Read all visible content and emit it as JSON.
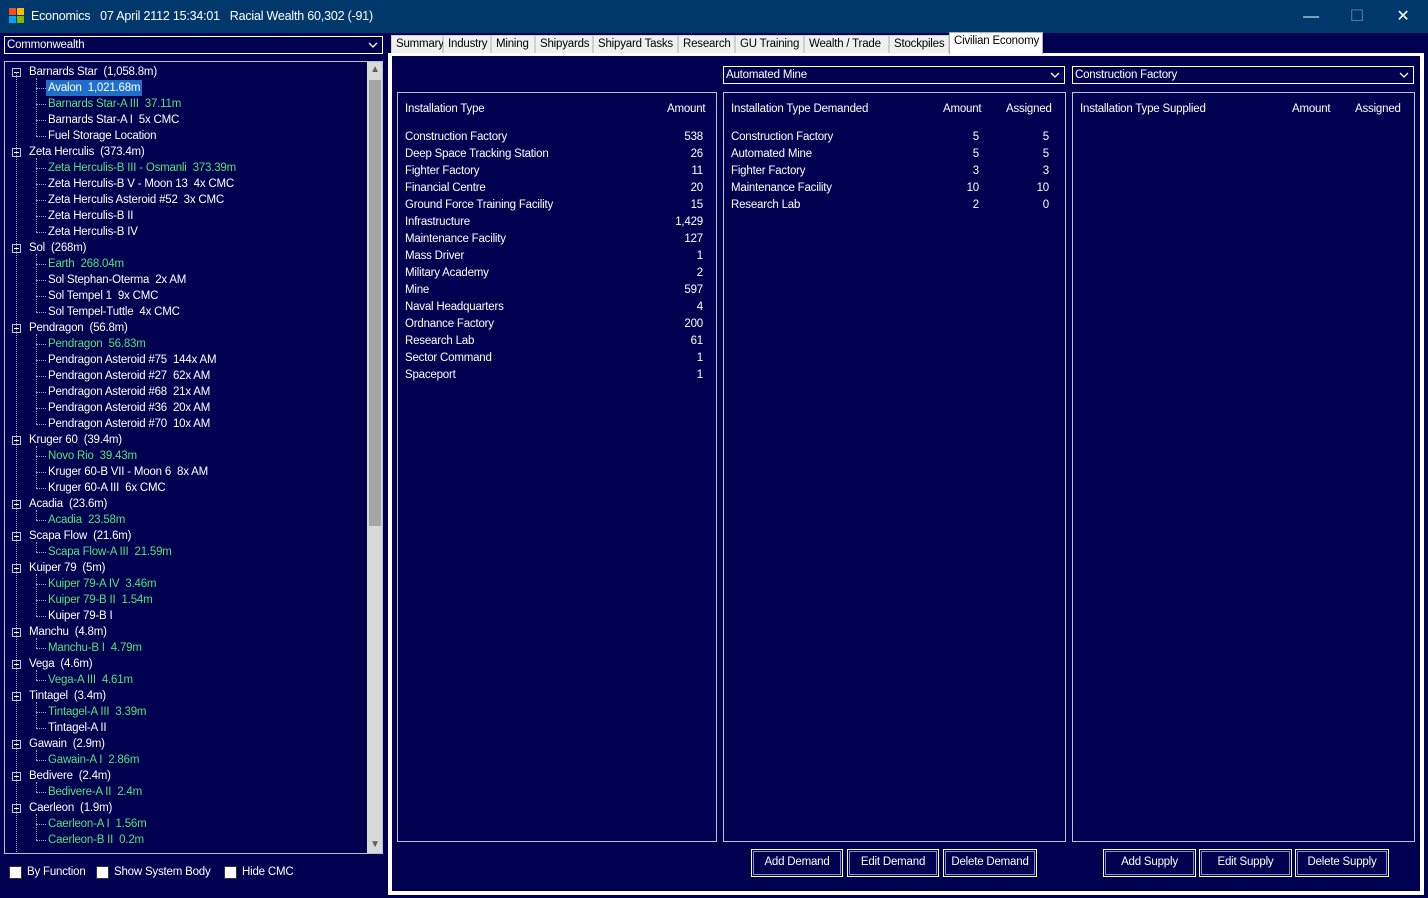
{
  "window": {
    "title": "Economics   07 April 2112 15:34:01   Racial Wealth 60,302 (-91)",
    "minimize_icon": "minimize-icon",
    "maximize_icon": "maximize-icon",
    "close_icon": "close-icon",
    "minimize_glyph": "—",
    "maximize_glyph": "☐",
    "close_glyph": "✕"
  },
  "race_select": {
    "value": "Commonwealth"
  },
  "tree": {
    "rows": [
      {
        "type": "system",
        "label": "Barnards Star  (1,058.8m)"
      },
      {
        "type": "body",
        "label": "Avalon  1,021.68m",
        "color": "green",
        "selected": true
      },
      {
        "type": "body",
        "label": "Barnards Star-A III  37.11m",
        "color": "green"
      },
      {
        "type": "body",
        "label": "Barnards Star-A I  5x CMC",
        "color": "white"
      },
      {
        "type": "body",
        "label": "Fuel Storage Location",
        "color": "white"
      },
      {
        "type": "system",
        "label": "Zeta Herculis  (373.4m)"
      },
      {
        "type": "body",
        "label": "Zeta Herculis-B III - Osmanli  373.39m",
        "color": "green"
      },
      {
        "type": "body",
        "label": "Zeta Herculis-B V - Moon 13  4x CMC",
        "color": "white"
      },
      {
        "type": "body",
        "label": "Zeta Herculis Asteroid #52  3x CMC",
        "color": "white"
      },
      {
        "type": "body",
        "label": "Zeta Herculis-B II",
        "color": "white"
      },
      {
        "type": "body",
        "label": "Zeta Herculis-B IV",
        "color": "white"
      },
      {
        "type": "system",
        "label": "Sol  (268m)"
      },
      {
        "type": "body",
        "label": "Earth  268.04m",
        "color": "green"
      },
      {
        "type": "body",
        "label": "Sol Stephan-Oterma  2x AM",
        "color": "white"
      },
      {
        "type": "body",
        "label": "Sol Tempel 1  9x CMC",
        "color": "white"
      },
      {
        "type": "body",
        "label": "Sol Tempel-Tuttle  4x CMC",
        "color": "white"
      },
      {
        "type": "system",
        "label": "Pendragon  (56.8m)"
      },
      {
        "type": "body",
        "label": "Pendragon  56.83m",
        "color": "green"
      },
      {
        "type": "body",
        "label": "Pendragon Asteroid #75  144x AM",
        "color": "white"
      },
      {
        "type": "body",
        "label": "Pendragon Asteroid #27  62x AM",
        "color": "white"
      },
      {
        "type": "body",
        "label": "Pendragon Asteroid #68  21x AM",
        "color": "white"
      },
      {
        "type": "body",
        "label": "Pendragon Asteroid #36  20x AM",
        "color": "white"
      },
      {
        "type": "body",
        "label": "Pendragon Asteroid #70  10x AM",
        "color": "white"
      },
      {
        "type": "system",
        "label": "Kruger 60  (39.4m)"
      },
      {
        "type": "body",
        "label": "Novo Rio  39.43m",
        "color": "green"
      },
      {
        "type": "body",
        "label": "Kruger 60-B VII - Moon 6  8x AM",
        "color": "white"
      },
      {
        "type": "body",
        "label": "Kruger 60-A III  6x CMC",
        "color": "white"
      },
      {
        "type": "system",
        "label": "Acadia  (23.6m)"
      },
      {
        "type": "body",
        "label": "Acadia  23.58m",
        "color": "green"
      },
      {
        "type": "system",
        "label": "Scapa Flow  (21.6m)"
      },
      {
        "type": "body",
        "label": "Scapa Flow-A III  21.59m",
        "color": "green"
      },
      {
        "type": "system",
        "label": "Kuiper 79  (5m)"
      },
      {
        "type": "body",
        "label": "Kuiper 79-A IV  3.46m",
        "color": "green"
      },
      {
        "type": "body",
        "label": "Kuiper 79-B II  1.54m",
        "color": "green"
      },
      {
        "type": "body",
        "label": "Kuiper 79-B I",
        "color": "white"
      },
      {
        "type": "system",
        "label": "Manchu  (4.8m)"
      },
      {
        "type": "body",
        "label": "Manchu-B I  4.79m",
        "color": "green"
      },
      {
        "type": "system",
        "label": "Vega  (4.6m)"
      },
      {
        "type": "body",
        "label": "Vega-A III  4.61m",
        "color": "green"
      },
      {
        "type": "system",
        "label": "Tintagel  (3.4m)"
      },
      {
        "type": "body",
        "label": "Tintagel-A III  3.39m",
        "color": "green"
      },
      {
        "type": "body",
        "label": "Tintagel-A II",
        "color": "white"
      },
      {
        "type": "system",
        "label": "Gawain  (2.9m)"
      },
      {
        "type": "body",
        "label": "Gawain-A I  2.86m",
        "color": "green"
      },
      {
        "type": "system",
        "label": "Bedivere  (2.4m)"
      },
      {
        "type": "body",
        "label": "Bedivere-A II  2.4m",
        "color": "green"
      },
      {
        "type": "system",
        "label": "Caerleon  (1.9m)"
      },
      {
        "type": "body",
        "label": "Caerleon-A I  1.56m",
        "color": "green"
      },
      {
        "type": "body",
        "label": "Caerleon-B II  0.2m",
        "color": "green"
      }
    ]
  },
  "checkboxes": {
    "by_function": "By Function",
    "show_system_body": "Show System Body",
    "hide_cmc": "Hide CMC"
  },
  "tabs": [
    {
      "label": "Summary"
    },
    {
      "label": "Industry"
    },
    {
      "label": "Mining"
    },
    {
      "label": "Shipyards"
    },
    {
      "label": "Shipyard Tasks"
    },
    {
      "label": "Research"
    },
    {
      "label": "GU Training"
    },
    {
      "label": "Wealth / Trade"
    },
    {
      "label": "Stockpiles"
    },
    {
      "label": "Civilian Economy",
      "active": true
    }
  ],
  "installations": {
    "headers": {
      "type": "Installation Type",
      "amount": "Amount"
    },
    "rows": [
      {
        "type": "Construction Factory",
        "amount": "538"
      },
      {
        "type": "Deep Space Tracking Station",
        "amount": "26"
      },
      {
        "type": "Fighter Factory",
        "amount": "11"
      },
      {
        "type": "Financial Centre",
        "amount": "20"
      },
      {
        "type": "Ground Force Training Facility",
        "amount": "15"
      },
      {
        "type": "Infrastructure",
        "amount": "1,429"
      },
      {
        "type": "Maintenance Facility",
        "amount": "127"
      },
      {
        "type": "Mass Driver",
        "amount": "1"
      },
      {
        "type": "Military Academy",
        "amount": "2"
      },
      {
        "type": "Mine",
        "amount": "597"
      },
      {
        "type": "Naval Headquarters",
        "amount": "4"
      },
      {
        "type": "Ordnance Factory",
        "amount": "200"
      },
      {
        "type": "Research Lab",
        "amount": "61"
      },
      {
        "type": "Sector Command",
        "amount": "1"
      },
      {
        "type": "Spaceport",
        "amount": "1"
      }
    ]
  },
  "demand": {
    "select_value": "Automated Mine",
    "headers": {
      "type": "Installation Type Demanded",
      "amount": "Amount",
      "assigned": "Assigned"
    },
    "rows": [
      {
        "type": "Construction Factory",
        "amount": "5",
        "assigned": "5"
      },
      {
        "type": "Automated Mine",
        "amount": "5",
        "assigned": "5"
      },
      {
        "type": "Fighter Factory",
        "amount": "3",
        "assigned": "3"
      },
      {
        "type": "Maintenance Facility",
        "amount": "10",
        "assigned": "10"
      },
      {
        "type": "Research Lab",
        "amount": "2",
        "assigned": "0"
      }
    ],
    "buttons": {
      "add": "Add Demand",
      "edit": "Edit Demand",
      "delete": "Delete Demand"
    }
  },
  "supply": {
    "select_value": "Construction Factory",
    "headers": {
      "type": "Installation Type Supplied",
      "amount": "Amount",
      "assigned": "Assigned"
    },
    "rows": [],
    "buttons": {
      "add": "Add Supply",
      "edit": "Edit Supply",
      "delete": "Delete Supply"
    }
  },
  "colors": {
    "background": "#000050",
    "titlebar": "#01386b",
    "populated_body": "#54e27c",
    "selection": "#1e70cc"
  }
}
